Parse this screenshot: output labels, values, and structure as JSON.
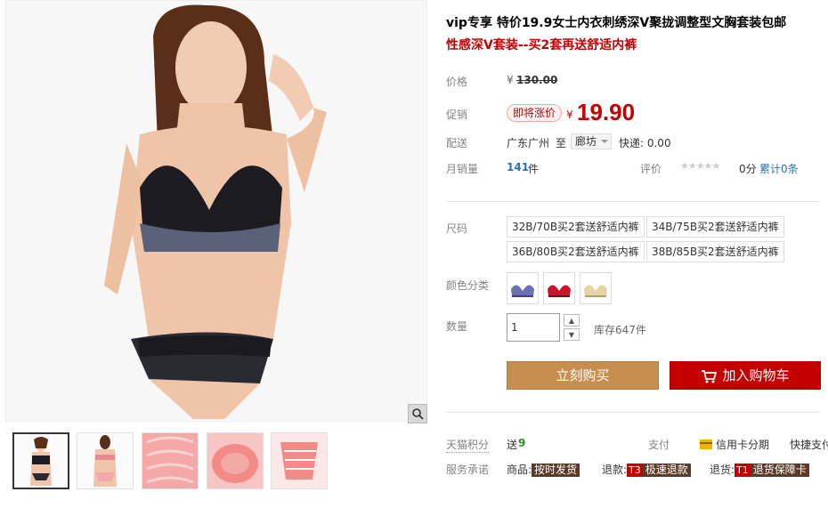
{
  "product": {
    "title": "vip专享 特价19.9女士内衣刺绣深V聚拢调整型文胸套装包邮",
    "subtitle": "性感深V套装--买2套再送舒适内裤"
  },
  "price": {
    "label": "价格",
    "currency": "¥",
    "original": "130.00",
    "promo_label": "促销",
    "promo_badge": "即将涨价",
    "promo_currency": "¥",
    "promo_value": "19.90"
  },
  "shipping": {
    "label": "配送",
    "origin": "广东广州",
    "to": "至",
    "destination": "廊坊",
    "fee": "快递: 0.00"
  },
  "sales": {
    "label": "月销量",
    "count": "141",
    "unit": "件",
    "rating_label": "评价",
    "stars": "★★★★★",
    "score": "0分",
    "total_reviews": "累计0条"
  },
  "size": {
    "label": "尺码",
    "options": [
      "32B/70B买2套送舒适内裤",
      "34B/75B买2套送舒适内裤",
      "36B/80B买2套送舒适内裤",
      "38B/85B买2套送舒适内裤"
    ]
  },
  "color": {
    "label": "颜色分类",
    "swatches": [
      "#6b6fb3",
      "#c9162c",
      "#e8d3a8"
    ]
  },
  "quantity": {
    "label": "数量",
    "value": "1",
    "stock": "库存647件"
  },
  "actions": {
    "buy_now": "立刻购买",
    "add_cart": "加入购物车"
  },
  "footer": {
    "points_label": "天猫积分",
    "points_prefix": "送",
    "points_value": "9",
    "pay_label": "支付",
    "credit": "信用卡分期",
    "quick": "快捷支付",
    "service_label": "服务承诺",
    "goods_label": "商品:",
    "goods_tag": "按时发货",
    "refund_label": "退款:",
    "refund_code": "T3",
    "refund_tag": "极速退款",
    "return_label": "退货:",
    "return_code": "T1",
    "return_tag": "退货保障卡"
  },
  "colors": {
    "accent_red": "#c40000",
    "buy_brown": "#c88e4f"
  }
}
